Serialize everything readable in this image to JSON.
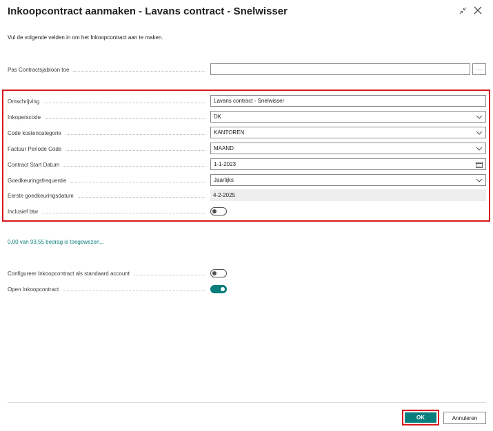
{
  "dialog": {
    "title": "Inkoopcontract aanmaken - Lavans contract - Snelwisser",
    "intro": "Vul de volgende velden in om het Inkoopcontract aan te maken."
  },
  "template": {
    "label": "Pas Contractsjabloon toe",
    "value": "",
    "more_label": "···"
  },
  "fields": {
    "omschrijving": {
      "label": "Omschrijving",
      "value": "Lavans contract - Snelwisser"
    },
    "inkoperscode": {
      "label": "Inkoperscode",
      "value": "DK"
    },
    "kostencategorie": {
      "label": "Code kostencategorie",
      "value": "KANTOREN"
    },
    "factuur_periode": {
      "label": "Factuur Periode Code",
      "value": "MAAND"
    },
    "start_datum": {
      "label": "Contract Start Datum",
      "value": "1-1-2023"
    },
    "goedkeuringsfrequentie": {
      "label": "Goedkeuringsfrequentie",
      "value": "Jaarlijks"
    },
    "eerste_goedkeuringsdatum": {
      "label": "Eerste goedkeuringsdatum",
      "value": "4-2-2025"
    },
    "inclusief_btw": {
      "label": "Inclusief btw",
      "on": false
    }
  },
  "assigned_link": "0,00 van 93,55 bedrag is toegewezen...",
  "options": {
    "standaard_account": {
      "label": "Configureer Inkoopcontract als standaard account",
      "on": false
    },
    "open_contract": {
      "label": "Open Inkoopcontract",
      "on": true
    }
  },
  "buttons": {
    "ok": "OK",
    "cancel": "Annuleren"
  },
  "colors": {
    "accent": "#0a7d7d",
    "highlight": "#d9171c"
  }
}
